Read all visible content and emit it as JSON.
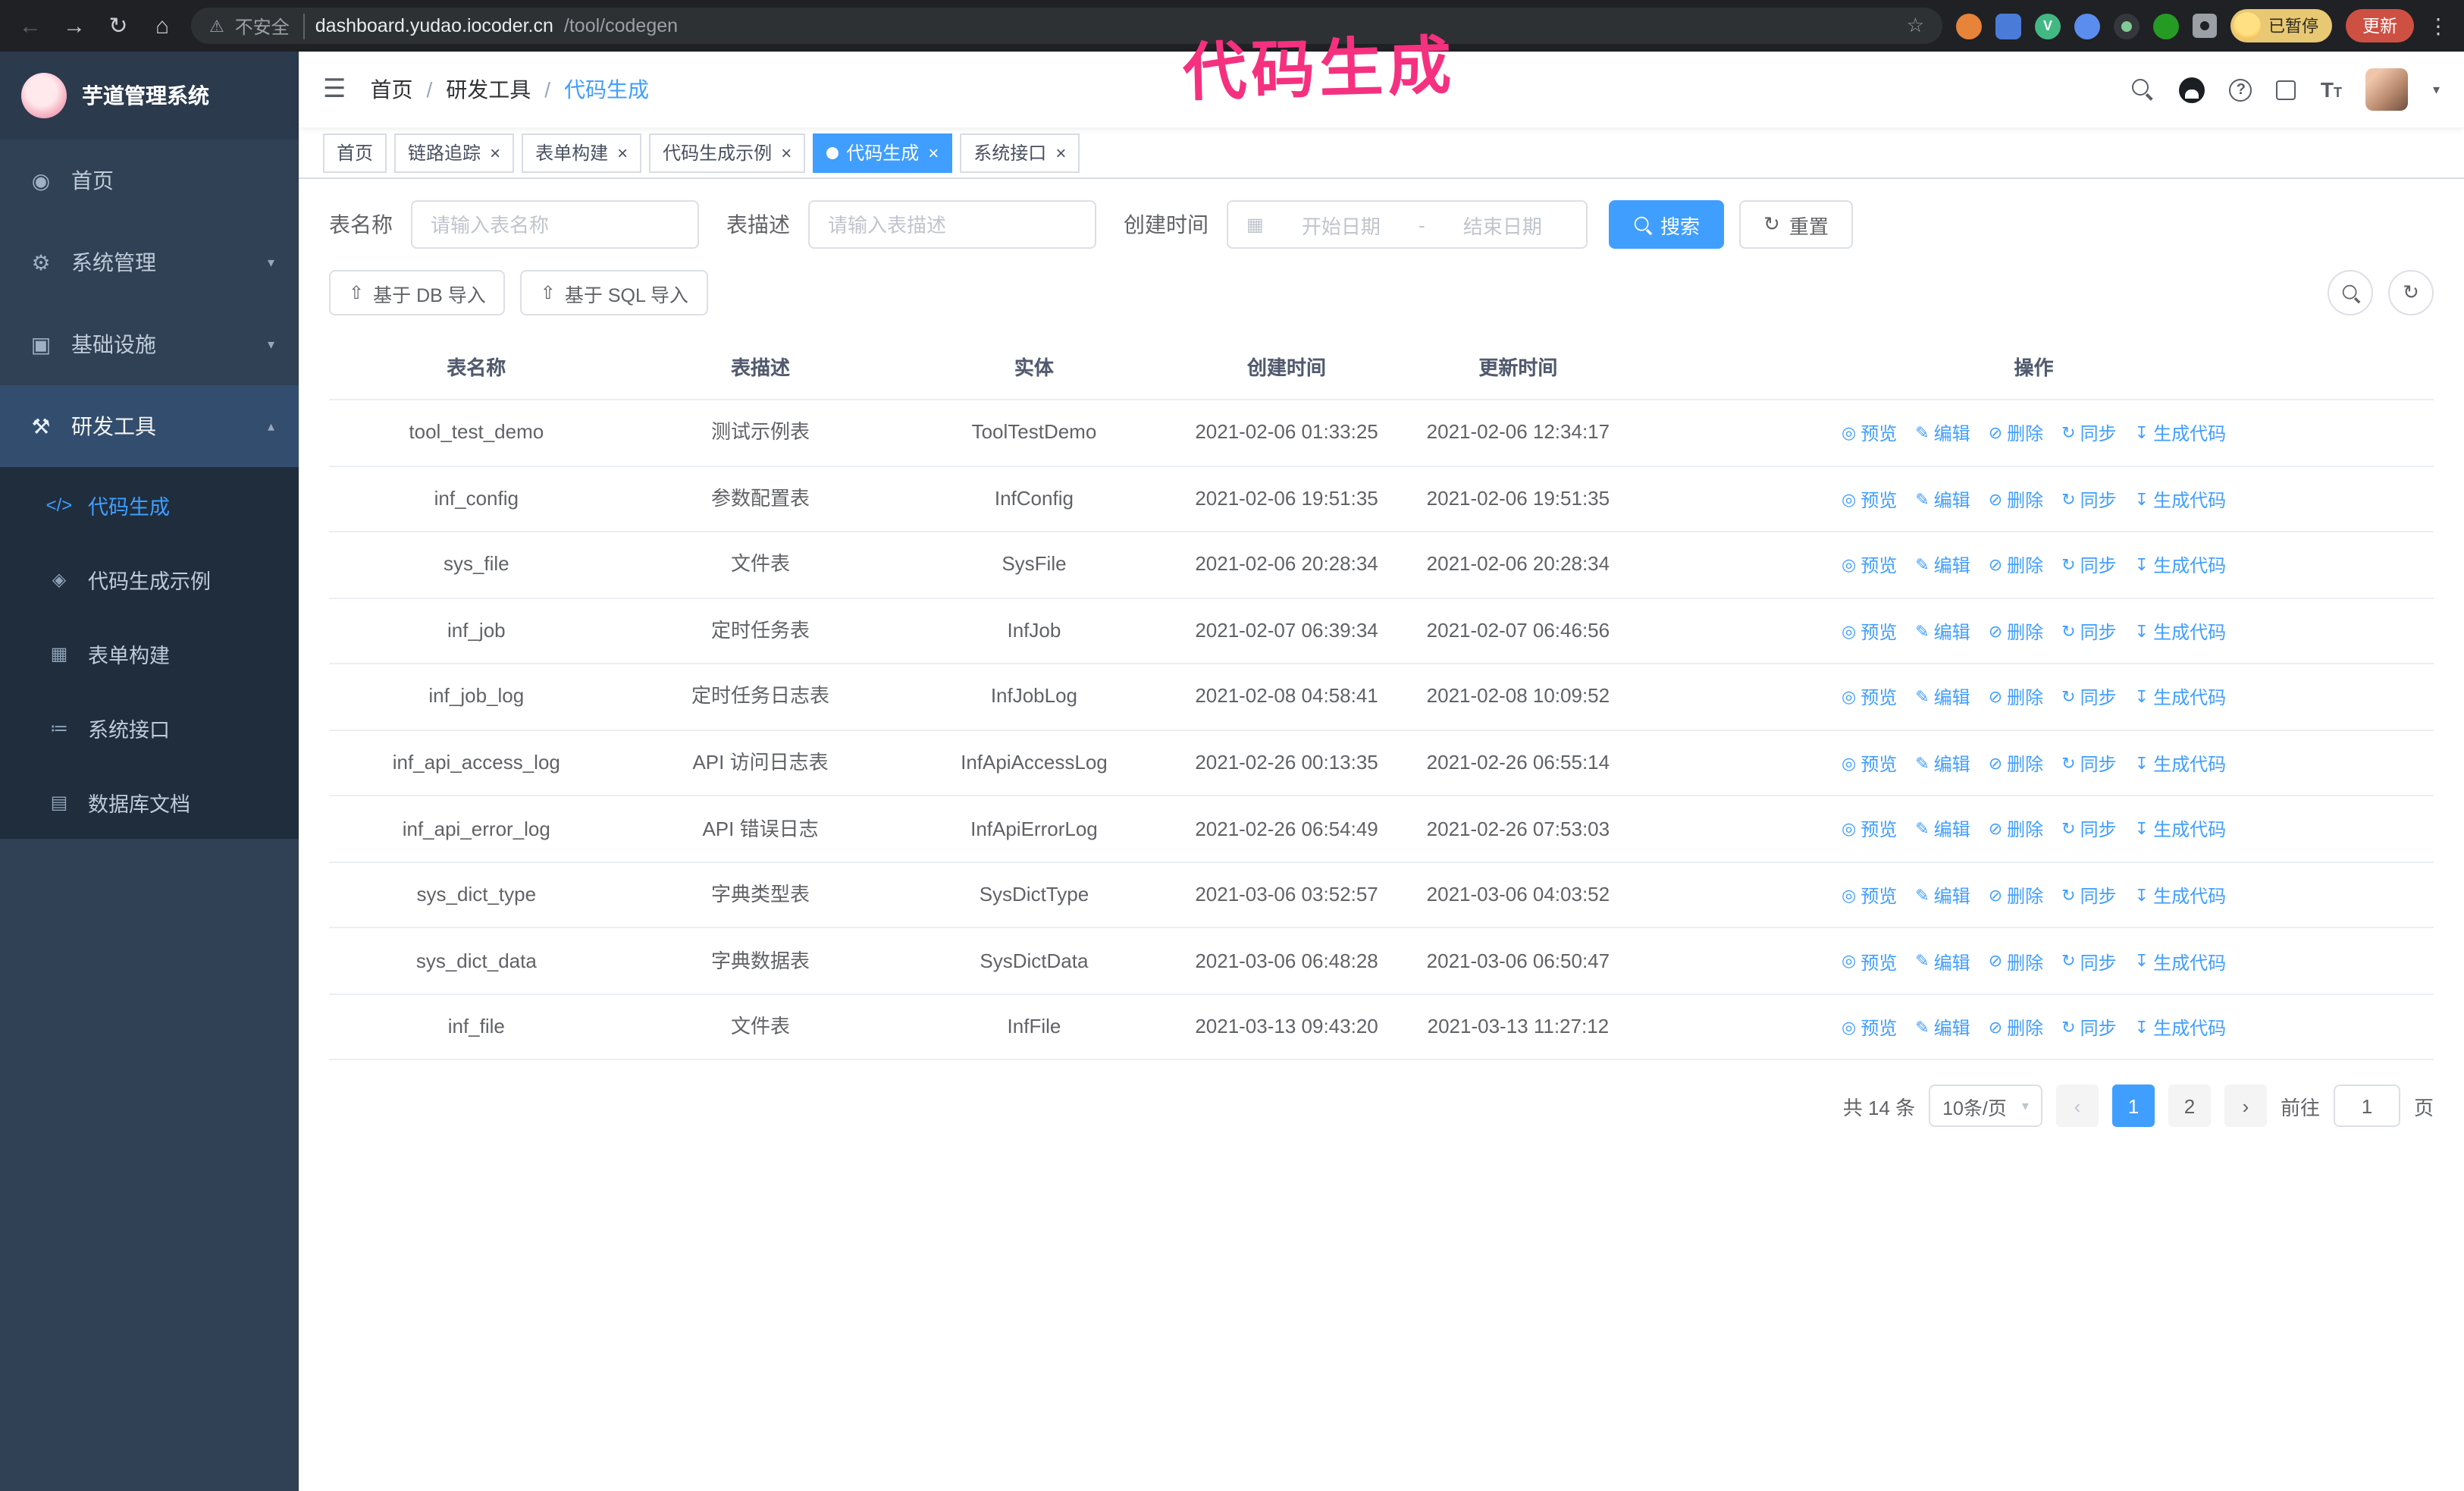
{
  "colors": {
    "accent": "#409eff",
    "sidebar_bg": "#304156",
    "submenu_bg": "#1f2d3d",
    "annotation": "#f5317f",
    "active_tab": "#409eff"
  },
  "annotation": {
    "text": "代码生成"
  },
  "browser": {
    "security_label": "不安全",
    "url_domain": "dashboard.yudao.iocoder.cn",
    "url_path": "/tool/codegen",
    "profile_badge": "已暂停",
    "update_button": "更新"
  },
  "sidebar": {
    "logo_title": "芋道管理系统",
    "items": [
      {
        "key": "home",
        "label": "首页",
        "icon": "dashboard-icon",
        "expandable": false,
        "expanded": false
      },
      {
        "key": "system",
        "label": "系统管理",
        "icon": "gear-icon",
        "expandable": true,
        "expanded": false
      },
      {
        "key": "infra",
        "label": "基础设施",
        "icon": "infrastructure-icon",
        "expandable": true,
        "expanded": false
      },
      {
        "key": "devtools",
        "label": "研发工具",
        "icon": "tools-icon",
        "expandable": true,
        "expanded": true
      }
    ],
    "submenu": [
      {
        "key": "codegen",
        "label": "代码生成",
        "icon": "code-icon",
        "active": true
      },
      {
        "key": "codegen-example",
        "label": "代码生成示例",
        "icon": "example-icon",
        "active": false
      },
      {
        "key": "form-builder",
        "label": "表单构建",
        "icon": "form-icon",
        "active": false
      },
      {
        "key": "api",
        "label": "系统接口",
        "icon": "api-icon",
        "active": false
      },
      {
        "key": "db-doc",
        "label": "数据库文档",
        "icon": "db-doc-icon",
        "active": false
      }
    ]
  },
  "navbar": {
    "breadcrumb": [
      "首页",
      "研发工具",
      "代码生成"
    ]
  },
  "tabs": [
    {
      "key": "home",
      "label": "首页",
      "closable": false,
      "active": false
    },
    {
      "key": "trace",
      "label": "链路追踪",
      "closable": true,
      "active": false
    },
    {
      "key": "form-builder",
      "label": "表单构建",
      "closable": true,
      "active": false
    },
    {
      "key": "codegen-example",
      "label": "代码生成示例",
      "closable": true,
      "active": false
    },
    {
      "key": "codegen",
      "label": "代码生成",
      "closable": true,
      "active": true
    },
    {
      "key": "api",
      "label": "系统接口",
      "closable": true,
      "active": false
    }
  ],
  "filters": {
    "table_name_label": "表名称",
    "table_name_placeholder": "请输入表名称",
    "table_desc_label": "表描述",
    "table_desc_placeholder": "请输入表描述",
    "create_time_label": "创建时间",
    "date_start_placeholder": "开始日期",
    "date_separator": "-",
    "date_end_placeholder": "结束日期",
    "search_button": "搜索",
    "reset_button": "重置"
  },
  "toolbar": {
    "import_db": "基于 DB 导入",
    "import_sql": "基于 SQL 导入"
  },
  "table": {
    "headers": [
      "表名称",
      "表描述",
      "实体",
      "创建时间",
      "更新时间",
      "操作"
    ],
    "actions": [
      {
        "key": "preview",
        "label": "预览",
        "icon": "eye-icon"
      },
      {
        "key": "edit",
        "label": "编辑",
        "icon": "edit-icon"
      },
      {
        "key": "delete",
        "label": "删除",
        "icon": "delete-icon"
      },
      {
        "key": "sync",
        "label": "同步",
        "icon": "sync-icon"
      },
      {
        "key": "generate",
        "label": "生成代码",
        "icon": "download-icon"
      }
    ],
    "rows": [
      {
        "name": "tool_test_demo",
        "desc": "测试示例表",
        "entity": "ToolTestDemo",
        "created": "2021-02-06 01:33:25",
        "updated": "2021-02-06 12:34:17"
      },
      {
        "name": "inf_config",
        "desc": "参数配置表",
        "entity": "InfConfig",
        "created": "2021-02-06 19:51:35",
        "updated": "2021-02-06 19:51:35"
      },
      {
        "name": "sys_file",
        "desc": "文件表",
        "entity": "SysFile",
        "created": "2021-02-06 20:28:34",
        "updated": "2021-02-06 20:28:34"
      },
      {
        "name": "inf_job",
        "desc": "定时任务表",
        "entity": "InfJob",
        "created": "2021-02-07 06:39:34",
        "updated": "2021-02-07 06:46:56"
      },
      {
        "name": "inf_job_log",
        "desc": "定时任务日志表",
        "entity": "InfJobLog",
        "created": "2021-02-08 04:58:41",
        "updated": "2021-02-08 10:09:52"
      },
      {
        "name": "inf_api_access_log",
        "desc": "API 访问日志表",
        "entity": "InfApiAccessLog",
        "created": "2021-02-26 00:13:35",
        "updated": "2021-02-26 06:55:14"
      },
      {
        "name": "inf_api_error_log",
        "desc": "API 错误日志",
        "entity": "InfApiErrorLog",
        "created": "2021-02-26 06:54:49",
        "updated": "2021-02-26 07:53:03"
      },
      {
        "name": "sys_dict_type",
        "desc": "字典类型表",
        "entity": "SysDictType",
        "created": "2021-03-06 03:52:57",
        "updated": "2021-03-06 04:03:52"
      },
      {
        "name": "sys_dict_data",
        "desc": "字典数据表",
        "entity": "SysDictData",
        "created": "2021-03-06 06:48:28",
        "updated": "2021-03-06 06:50:47"
      },
      {
        "name": "inf_file",
        "desc": "文件表",
        "entity": "InfFile",
        "created": "2021-03-13 09:43:20",
        "updated": "2021-03-13 11:27:12"
      }
    ]
  },
  "pagination": {
    "total": "共 14 条",
    "page_size": "10条/页",
    "pages": [
      "1",
      "2"
    ],
    "active_page": "1",
    "goto_label": "前往",
    "goto_value": "1",
    "goto_suffix": "页"
  }
}
